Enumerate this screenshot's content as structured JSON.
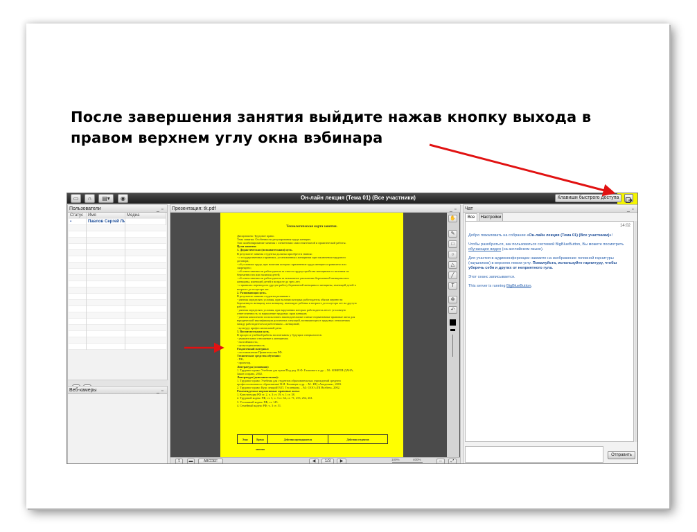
{
  "slide": {
    "heading_line1": "После завершения занятия выйдите нажав кнопку выхода в",
    "heading_line2": "правом верхнем углу окна вэбинара"
  },
  "app": {
    "title": "Он-лайн лекция (Тема 01) (Все участники)",
    "shortcut_label": "Клавиши быстрого доступа",
    "highlight_color": "#f5f500"
  },
  "users": {
    "title": "Пользователи",
    "columns": [
      "Статус",
      "Имя",
      "Медиа"
    ],
    "rows": [
      {
        "name": "Павлов Сергей Львович"
      }
    ]
  },
  "webcams": {
    "title": "Веб-камеры"
  },
  "presentation": {
    "title": "Презентация: tk.pdf",
    "page_label": "1/3",
    "zoom_min": "100%",
    "zoom_max": "400%",
    "font_label": "ABCDEF",
    "doc_color": "#ffff00",
    "doc": {
      "title": "Технологическая карта занятия.",
      "lines": [
        {
          "t": "Дисциплина: Трудовое право.",
          "b": false
        },
        {
          "t": "Тема занятия: Особенности регулирования труда женщин.",
          "b": false
        },
        {
          "t": "Тип: комбинирование занятия с элементами самостоятельной и практической работы.",
          "b": false
        },
        {
          "t": "Цели занятия:",
          "b": true
        },
        {
          "t": "1.  Дидактическая (познавательная) цель.",
          "b": true
        },
        {
          "t": "В результате занятия студенты должны приобрести знания:",
          "b": false
        },
        {
          "t": "-  о государственных гарантиях, установленных женщинам при заключении трудового",
          "b": false
        },
        {
          "t": "   договора;",
          "b": false
        },
        {
          "t": "-  об условиях труда, при наличии которых применение труда женщин ограничено или",
          "b": false
        },
        {
          "t": "   запрещено;",
          "b": false
        },
        {
          "t": "-  об ответственности работодателя за отказ в трудоустройстве женщинам по мотивам их",
          "b": false
        },
        {
          "t": "   беременности или наличия детей;",
          "b": false
        },
        {
          "t": "-  об ответственности работодателя за незаконное увольнение беременной женщины или",
          "b": false
        },
        {
          "t": "   женщины, имеющей детей в возрасте до трех лет;",
          "b": false
        },
        {
          "t": "-  о правилах перевода на другую работу беременной женщины и женщины, имеющей детей в",
          "b": false
        },
        {
          "t": "   возрасте до полутора лет.",
          "b": false
        },
        {
          "t": "2.  Развивающая цель.",
          "b": true
        },
        {
          "t": "В результате занятия студенты развивают:",
          "b": false
        },
        {
          "t": "-  умения определять условия, при наличии которых работодатель обязан перевести",
          "b": false
        },
        {
          "t": "   беременную женщину или женщину, имеющую ребенка в возрасте до полутора лет на другую",
          "b": false
        },
        {
          "t": "   работу;",
          "b": false
        },
        {
          "t": "-  умения определять условия, при нарушении которых работодатель несет уголовную",
          "b": false
        },
        {
          "t": "   ответственность за нарушение трудовых прав женщин;",
          "b": false
        },
        {
          "t": "-  умения комплексно использовать законодательные и иные нормативные правовые акты для",
          "b": false
        },
        {
          "t": "   юридической квалификации различных ситуаций, возникающих в трудовых отношениях",
          "b": false
        },
        {
          "t": "   между работодателем и работником – женщиной;",
          "b": false
        },
        {
          "t": "-  культуру профессиональной речи.",
          "b": false
        },
        {
          "t": "3.  Воспитательная цель.",
          "b": true
        },
        {
          "t": "В процессе учебной работы воспитывать у будущих специалистов:",
          "b": false
        },
        {
          "t": "-  уважительное отношение к женщинам;",
          "b": false
        },
        {
          "t": "-  настойчивость;",
          "b": false
        },
        {
          "t": "-  целеустремленность.",
          "b": false
        },
        {
          "t": "Раздаточный материал:",
          "b": true
        },
        {
          "t": "-  постановление Правительства РФ.",
          "b": false
        },
        {
          "t": "Технические средства обучения:",
          "b": true
        },
        {
          "t": "-  ПК;",
          "b": false
        },
        {
          "t": "-  проектор.",
          "b": false
        },
        {
          "t": "Литература (основная):",
          "b": true
        },
        {
          "t": "1.  Трудовое право: Учебник для вузов/Под ред. В.Ф. Галкиного и др. – М.: ЮНИТИ-ДАНА,",
          "b": false
        },
        {
          "t": "    Закон и право, 2002.",
          "b": false
        },
        {
          "t": "Литература (дополнительная):",
          "b": true
        },
        {
          "t": "1.  Трудовое право: Учебник для студентов образовательных учреждений среднего",
          "b": false
        },
        {
          "t": "    профессионального образования/ В.И. Казанцев и др. – М.: ИЦ «Академия», 2003.",
          "b": false
        },
        {
          "t": "2.  Трудовое право: Курс лекций/ В.П. Тесленкова. – М.: ООО «ТК Велбен», 2002.",
          "b": false
        },
        {
          "t": "Рекомендуемые нормативные правовые акты:",
          "b": true
        },
        {
          "t": "1.  Конституция РФ ст. 2, ч. 3 ст. 19, ч. 1 ст. 38.",
          "b": false
        },
        {
          "t": "2.  Трудовой кодекс РФ; ст. 3, ч. 3 ст. 64, ст. 71, 253, 254, 261.",
          "b": false
        },
        {
          "t": "3.  Уголовный кодекс РФ; ст. 145.",
          "b": false
        },
        {
          "t": "4.  Семейный кодекс РФ; ч. 3 ст. 51.",
          "b": false
        }
      ],
      "table_headers": [
        "Этап",
        "Время занятия",
        "Действия преподавателя",
        "Действия студентов"
      ]
    }
  },
  "chat": {
    "title": "Чат",
    "tabs": [
      "Все",
      "Настройки"
    ],
    "time": "14:02",
    "msg1_pre": "Добро пожаловать на собрание ",
    "msg1_bold": "«Он-лайн лекция (Тема 01) (Все участники)»",
    "msg1_post": "!",
    "msg2_pre": "Чтобы разобраться, как пользоваться системой BigBlueButton, Вы можете посмотреть ",
    "msg2_link": "обучающее видео",
    "msg2_post": " (на английском языке).",
    "msg3_pre": "Для участия в аудиоконференции нажмите на изображение головной гарнитуры (наушников) в верхнем левом углу. ",
    "msg3_bold": "Пожалуйста, используйте гарнитуру, чтобы уберечь себя и других от неприятного гула.",
    "msg4": "Этот сеанс записывается.",
    "msg5_pre": "This server is running ",
    "msg5_link": "BigBlueButton",
    "msg5_post": ".",
    "send_label": "Отправить"
  },
  "annotation_color": "#e11212"
}
